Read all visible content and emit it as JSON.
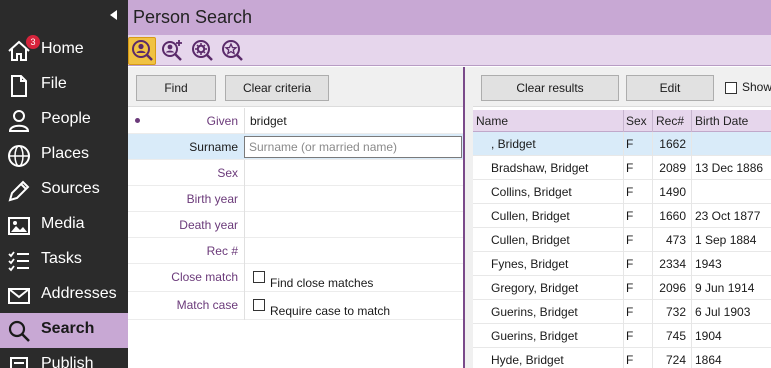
{
  "sidebar": {
    "items": [
      {
        "label": "Home",
        "icon": "home-icon",
        "badge": "3"
      },
      {
        "label": "File",
        "icon": "file-icon"
      },
      {
        "label": "People",
        "icon": "person-icon"
      },
      {
        "label": "Places",
        "icon": "globe-icon"
      },
      {
        "label": "Sources",
        "icon": "pen-icon"
      },
      {
        "label": "Media",
        "icon": "image-icon"
      },
      {
        "label": "Tasks",
        "icon": "checklist-icon"
      },
      {
        "label": "Addresses",
        "icon": "envelope-icon"
      },
      {
        "label": "Search",
        "icon": "search-icon",
        "active": true
      },
      {
        "label": "Publish",
        "icon": "publish-icon"
      }
    ]
  },
  "header": {
    "title": "Person Search"
  },
  "toolbar": {
    "buttons": [
      "person-search-icon",
      "person-add-search-icon",
      "gear-search-icon",
      "star-search-icon"
    ]
  },
  "criteria": {
    "find_label": "Find",
    "clear_label": "Clear criteria",
    "fields": {
      "given": {
        "label": "Given",
        "value": "bridget"
      },
      "surname": {
        "label": "Surname",
        "placeholder": "Surname (or married name)"
      },
      "sex": {
        "label": "Sex"
      },
      "birth_year": {
        "label": "Birth year"
      },
      "death_year": {
        "label": "Death year"
      },
      "rec": {
        "label": "Rec #"
      },
      "close_match": {
        "label": "Close match",
        "option": "Find close matches"
      },
      "match_case": {
        "label": "Match case",
        "option": "Require case to match"
      }
    }
  },
  "results": {
    "clear_label": "Clear results",
    "edit_label": "Edit",
    "show_label": "Show",
    "columns": [
      "Name",
      "Sex",
      "Rec#",
      "Birth Date"
    ],
    "rows": [
      {
        "name": ", Bridget",
        "sex": "F",
        "rec": "1662",
        "birth": ""
      },
      {
        "name": "Bradshaw, Bridget",
        "sex": "F",
        "rec": "2089",
        "birth": "13 Dec 1886"
      },
      {
        "name": "Collins, Bridget",
        "sex": "F",
        "rec": "1490",
        "birth": ""
      },
      {
        "name": "Cullen, Bridget",
        "sex": "F",
        "rec": "1660",
        "birth": "23 Oct 1877"
      },
      {
        "name": "Cullen, Bridget",
        "sex": "F",
        "rec": "473",
        "birth": "1 Sep 1884"
      },
      {
        "name": "Fynes, Bridget",
        "sex": "F",
        "rec": "2334",
        "birth": "1943"
      },
      {
        "name": "Gregory, Bridget",
        "sex": "F",
        "rec": "2096",
        "birth": "9 Jun 1914"
      },
      {
        "name": "Guerins, Bridget",
        "sex": "F",
        "rec": "732",
        "birth": "6 Jul 1903"
      },
      {
        "name": "Guerins, Bridget",
        "sex": "F",
        "rec": "745",
        "birth": "1904"
      },
      {
        "name": "Hyde, Bridget",
        "sex": "F",
        "rec": "724",
        "birth": "1864"
      }
    ]
  },
  "colors": {
    "accent": "#c8a8d4",
    "toolbar_bg": "#e6d6ec",
    "sidebar_bg": "#2b2b2b",
    "selected_row": "#d9ebf9",
    "label_purple": "#6b3a7a",
    "badge_red": "#d6233b"
  }
}
